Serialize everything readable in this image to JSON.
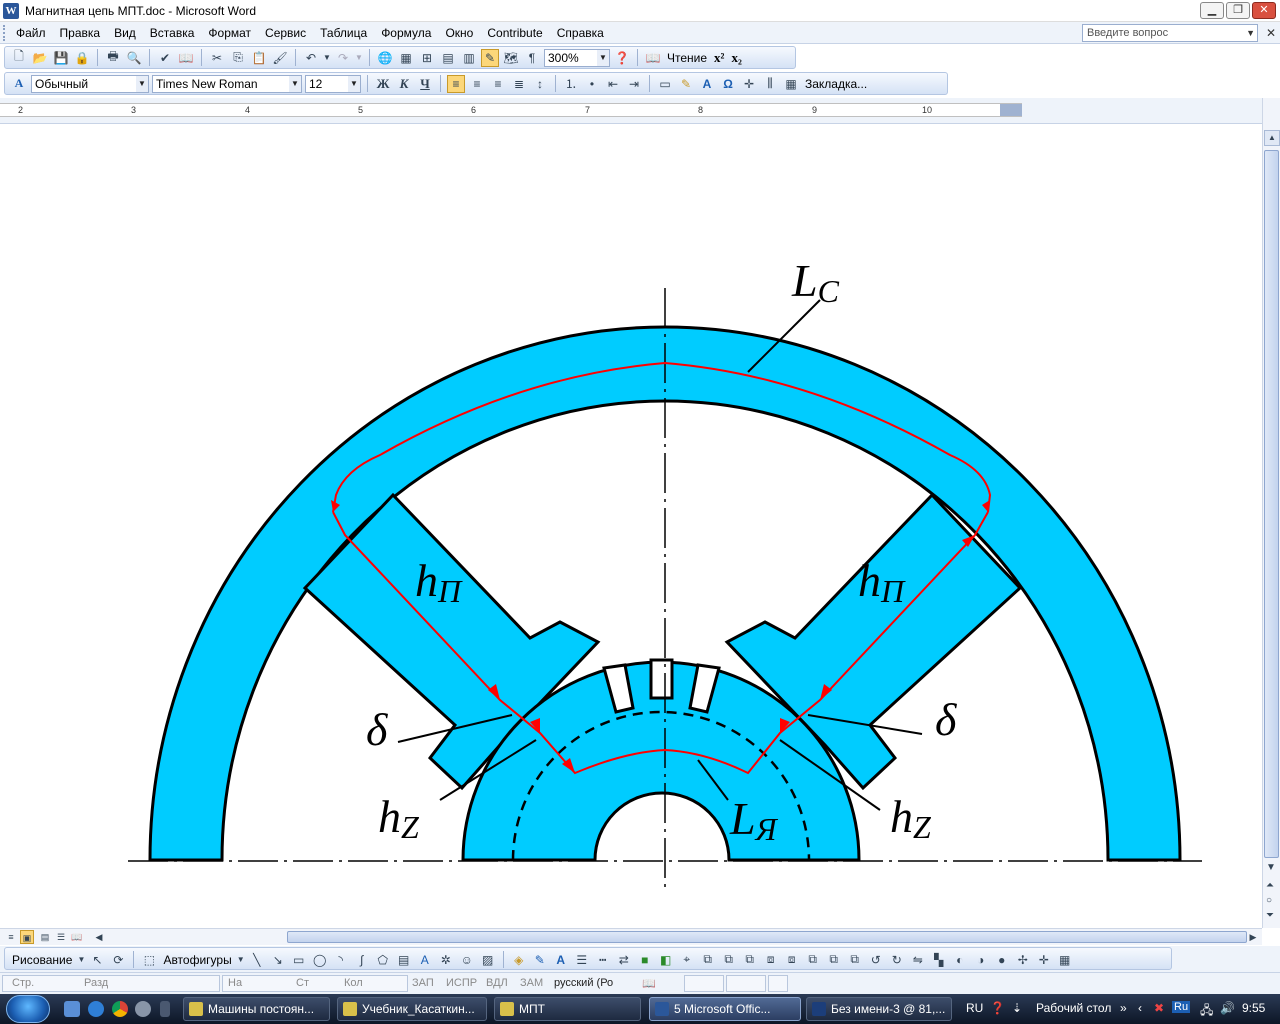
{
  "window": {
    "title": "Магнитная цепь МПТ.doc - Microsoft Word",
    "app_icon": "W"
  },
  "menu": {
    "items": [
      "Файл",
      "Правка",
      "Вид",
      "Вставка",
      "Формат",
      "Сервис",
      "Таблица",
      "Формула",
      "Окно",
      "Contribute",
      "Справка"
    ],
    "help_placeholder": "Введите вопрос"
  },
  "standard_toolbar": {
    "zoom": "300%",
    "reading_label": "Чтение",
    "superscript": "x²",
    "subscript": "x₂"
  },
  "format_toolbar": {
    "style": "Обычный",
    "font": "Times New Roman",
    "size": "12",
    "bold": "Ж",
    "italic": "К",
    "underline": "Ч",
    "bookmark": "Закладка..."
  },
  "ruler": {
    "labels": [
      "2",
      "3",
      "4",
      "5",
      "6",
      "7",
      "8",
      "9",
      "10"
    ]
  },
  "figure": {
    "label_lc": "L",
    "label_lc_sub": "C",
    "label_hp_left": "h",
    "label_hp_left_sub": "П",
    "label_hp_right": "h",
    "label_hp_right_sub": "П",
    "label_delta_left": "δ",
    "label_delta_right": "δ",
    "label_hz_left": "h",
    "label_hz_left_sub": "Z",
    "label_hz_right": "h",
    "label_hz_right_sub": "Z",
    "label_la": "L",
    "label_la_sub": "Я",
    "colors": {
      "steel": "#00ccff",
      "flux_path": "#ff0000",
      "outline": "#000000"
    }
  },
  "drawing_toolbar": {
    "drawing_label": "Рисование",
    "autoshapes_label": "Автофигуры"
  },
  "status_bar": {
    "page": "Стр.",
    "section": "Разд",
    "at": "На",
    "line": "Ст",
    "col": "Кол",
    "rec": "ЗАП",
    "trk": "ИСПР",
    "ext": "ВДЛ",
    "ovr": "ЗАМ",
    "language": "русский (Ро"
  },
  "taskbar": {
    "tasks": [
      "Машины постоян...",
      "Учебник_Касаткин...",
      "МПТ",
      "5 Microsoft Offic...",
      "Без имени-3 @ 81,..."
    ],
    "lang": "RU",
    "desktop": "Рабочий стол",
    "time": "9:55"
  }
}
